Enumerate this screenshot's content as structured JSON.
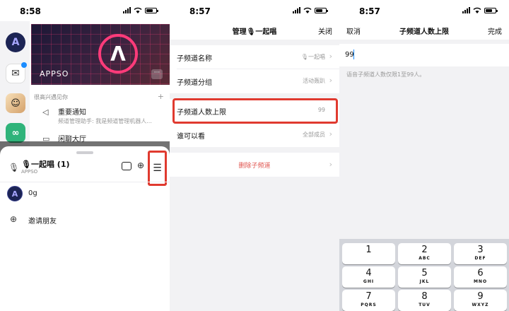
{
  "panel1": {
    "status_time": "8:58",
    "banner_brand": "APPSO",
    "section_title": "很高兴遇见你",
    "section_plus": "+",
    "channels": [
      {
        "title": "重要通知",
        "subtitle": "频道管理助手: 我是频道管理机器人..."
      },
      {
        "title": "闲聊大厅",
        "subtitle": ""
      }
    ],
    "sheet": {
      "title": "🎙一起唱 (1)",
      "subtitle": "APPSO",
      "members": [
        {
          "avatar": "A",
          "name": "0g"
        }
      ],
      "invite_label": "邀请朋友"
    }
  },
  "panel2": {
    "status_time": "8:57",
    "nav_title": "管理🎙一起唱",
    "nav_close": "关闭",
    "rows": [
      {
        "label": "子频道名称",
        "value": "🎙一起唱"
      },
      {
        "label": "子频道分组",
        "value": "活动轰趴"
      },
      {
        "label": "子频道人数上限",
        "value": "99"
      },
      {
        "label": "谁可以看",
        "value": "全部成员"
      }
    ],
    "delete_label": "删除子频道"
  },
  "panel3": {
    "status_time": "8:57",
    "nav_cancel": "取消",
    "nav_title": "子频道人数上限",
    "nav_done": "完成",
    "input_value": "99",
    "hint": "语音子频道人数仅限1至99人。",
    "keys": [
      {
        "num": "1",
        "letters": ""
      },
      {
        "num": "2",
        "letters": "ABC"
      },
      {
        "num": "3",
        "letters": "DEF"
      },
      {
        "num": "4",
        "letters": "GHI"
      },
      {
        "num": "5",
        "letters": "JKL"
      },
      {
        "num": "6",
        "letters": "MNO"
      },
      {
        "num": "7",
        "letters": "PQRS"
      },
      {
        "num": "8",
        "letters": "TUV"
      },
      {
        "num": "9",
        "letters": "WXYZ"
      }
    ]
  },
  "colors": {
    "highlight": "#e03a2f",
    "delete_text": "#e0524c",
    "accent": "#1b8cff"
  }
}
